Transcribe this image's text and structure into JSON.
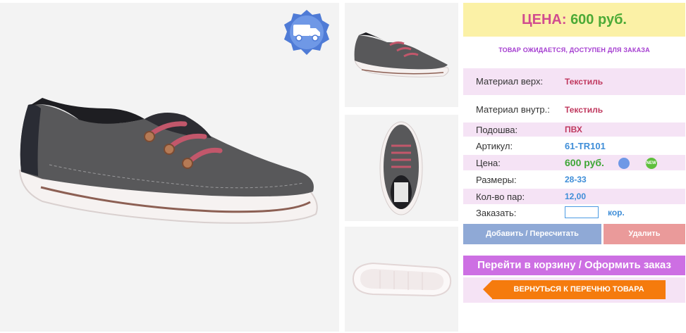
{
  "price_header": {
    "label": "ЦЕНА:",
    "value": "600 руб."
  },
  "status_note": "ТОВАР ОЖИДАЕТСЯ, ДОСТУПЕН ДЛЯ ЗАКАЗА",
  "specs": [
    {
      "key": "Материал верх:",
      "value": "Текстиль"
    },
    {
      "key": "Материал внутр.:",
      "value": "Текстиль"
    },
    {
      "key": "Подошва:",
      "value": "ПВХ"
    },
    {
      "key": "Артикул:",
      "value": "61-TR101"
    },
    {
      "key": "Цена:",
      "value": "600 руб."
    },
    {
      "key": "Размеры:",
      "value": "28-33"
    },
    {
      "key": "Кол-во пар:",
      "value": "12,00"
    }
  ],
  "order": {
    "label": "Заказать:",
    "quantity_value": "",
    "unit": "кор."
  },
  "badges": {
    "new": "NEW"
  },
  "buttons": {
    "add": "Добавить / Пересчитать",
    "delete": "Удалить",
    "cart": "Перейти в корзину / Оформить заказ",
    "back": "ВЕРНУТЬСЯ К ПЕРЕЧНЮ ТОВАРА"
  },
  "icons": {
    "delivery": "delivery-truck-badge-icon"
  },
  "colors": {
    "price_label": "#d14c8f",
    "price_value": "#4caa36",
    "accent_purple": "#cd6fe3",
    "orange": "#f57b0d"
  }
}
